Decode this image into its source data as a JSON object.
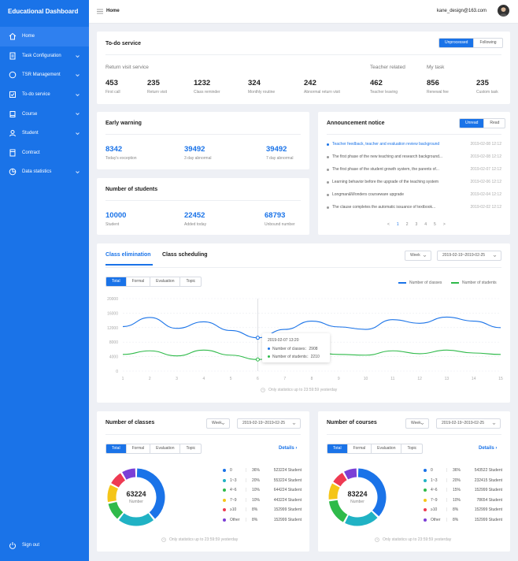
{
  "brand": "Educational Dashboard",
  "nav": [
    {
      "label": "Home",
      "icon": "home-icon",
      "active": true
    },
    {
      "label": "Task Configuration",
      "icon": "document-icon",
      "chevron": true
    },
    {
      "label": "TSR Management",
      "icon": "chat-icon",
      "chevron": true
    },
    {
      "label": "To-do service",
      "icon": "checklist-icon",
      "chevron": true
    },
    {
      "label": "Course",
      "icon": "book-icon",
      "chevron": true
    },
    {
      "label": "Student",
      "icon": "user-icon",
      "chevron": true
    },
    {
      "label": "Contract",
      "icon": "contract-icon"
    },
    {
      "label": "Data statistics",
      "icon": "pie-icon",
      "chevron": true
    }
  ],
  "signout": "Sign out",
  "topbar": {
    "crumb": "Home",
    "user": "kane_design@163.com"
  },
  "todo": {
    "title": "To-do service",
    "seg": [
      "Unprocessed",
      "Following"
    ],
    "group1": "Return visit service",
    "group2": "Teacher related",
    "group3": "My task",
    "stats": [
      {
        "n": "453",
        "l": "First call"
      },
      {
        "n": "235",
        "l": "Return visit"
      },
      {
        "n": "1232",
        "l": "Class reminder"
      },
      {
        "n": "324",
        "l": "Monthly routine"
      },
      {
        "n": "242",
        "l": "Abnormal return visit"
      },
      {
        "n": "462",
        "l": "Teacher leaving"
      },
      {
        "n": "856",
        "l": "Renewal fee"
      },
      {
        "n": "235",
        "l": "Custom task"
      }
    ]
  },
  "warning": {
    "title": "Early warning",
    "stats": [
      {
        "n": "8342",
        "l": "Today's exception"
      },
      {
        "n": "39492",
        "l": "3 day abnormal"
      },
      {
        "n": "39492",
        "l": "7 day abnormal"
      }
    ]
  },
  "students": {
    "title": "Number of students",
    "stats": [
      {
        "n": "10000",
        "l": "Student"
      },
      {
        "n": "22452",
        "l": "Added today"
      },
      {
        "n": "68793",
        "l": "Unbound number"
      }
    ]
  },
  "announce": {
    "title": "Announcement notice",
    "seg": [
      "Unread",
      "Read"
    ],
    "rows": [
      {
        "t": "Teacher feedback, teacher and evaluation review background",
        "d": "2019-02-08 12:12"
      },
      {
        "t": "The first phase of the new teaching and research background...",
        "d": "2019-02-08 12:12"
      },
      {
        "t": "The first phase of the student growth system, the parents of...",
        "d": "2019-02-07 12:12"
      },
      {
        "t": "Learning behavior before the upgrade of the teaching system",
        "d": "2019-02-06 12:12"
      },
      {
        "t": "Longman&Wonders courseware upgrade",
        "d": "2019-02-04 12:12"
      },
      {
        "t": "The clause completes the automatic issuance of textbook...",
        "d": "2019-02-02 12:12"
      }
    ],
    "pager": [
      "<",
      "1",
      "2",
      "3",
      "4",
      "5",
      ">"
    ]
  },
  "elim": {
    "tab1": "Class elimination",
    "tab2": "Class scheduling",
    "period": "Week",
    "range": "2019-02-19~2019-02-25",
    "seg": [
      "Total",
      "Formal",
      "Evaluation",
      "Topic"
    ],
    "legend1": "Number of classes",
    "legend2": "Number of students",
    "tooltip": {
      "date": "2019-02-07 13:20",
      "l1": "Number of classes：",
      "v1": "2908",
      "l2": "Number of students：",
      "v2": "2210"
    },
    "foot": "Only statistics up to 23:59:59 yesterday"
  },
  "chart_data": {
    "type": "line",
    "x": [
      "1",
      "2",
      "3",
      "4",
      "5",
      "6",
      "7",
      "8",
      "9",
      "10",
      "11",
      "12",
      "13",
      "14",
      "15"
    ],
    "ylim": [
      0,
      20000
    ],
    "yticks": [
      "0",
      "4000",
      "8000",
      "12000",
      "16000",
      "20000"
    ],
    "series": [
      {
        "name": "Number of classes",
        "color": "#1a73e8",
        "values": [
          12300,
          14800,
          11800,
          13600,
          11200,
          9200,
          11500,
          13800,
          12200,
          11500,
          14200,
          13200,
          14900,
          13800,
          12000
        ]
      },
      {
        "name": "Number of students",
        "color": "#2fba4a",
        "values": [
          4600,
          5600,
          4200,
          5800,
          4400,
          3200,
          4200,
          5200,
          4600,
          4400,
          5600,
          4800,
          5800,
          5000,
          4600
        ]
      }
    ]
  },
  "classes": {
    "title": "Number of classes",
    "period": "Week",
    "range": "2019-02-19~2019-02-25",
    "seg": [
      "Total",
      "Formal",
      "Evaluation",
      "Topic"
    ],
    "details": "Details",
    "center": "63224",
    "center_label": "Number",
    "rows": [
      {
        "n": "0",
        "p": "36%",
        "s": "523224 Student",
        "c": "#1a73e8"
      },
      {
        "n": "1~3",
        "p": "20%",
        "s": "553224 Student",
        "c": "#20b2c4"
      },
      {
        "n": "4~6",
        "p": "10%",
        "s": "644224 Student",
        "c": "#2fba4a"
      },
      {
        "n": "7~9",
        "p": "10%",
        "s": "443224 Student",
        "c": "#f5c518"
      },
      {
        "n": "≥10",
        "p": "8%",
        "s": "152999 Student",
        "c": "#ee3a52"
      },
      {
        "n": "Other",
        "p": "8%",
        "s": "152999 Student",
        "c": "#7b3fd6"
      }
    ],
    "foot": "Only statistics up to 23:59:59 yesterday"
  },
  "courses": {
    "title": "Number of courses",
    "period": "Week",
    "range": "2019-02-19~2019-02-25",
    "seg": [
      "Total",
      "Formal",
      "Evaluation",
      "Topic"
    ],
    "details": "Details",
    "center": "83224",
    "center_label": "Number",
    "rows": [
      {
        "n": "0",
        "p": "36%",
        "s": "543522 Student",
        "c": "#1a73e8"
      },
      {
        "n": "1~3",
        "p": "20%",
        "s": "232415 Student",
        "c": "#20b2c4"
      },
      {
        "n": "4~6",
        "p": "15%",
        "s": "152999 Student",
        "c": "#2fba4a"
      },
      {
        "n": "7~9",
        "p": "10%",
        "s": "78654 Student",
        "c": "#f5c518"
      },
      {
        "n": "≥10",
        "p": "8%",
        "s": "152999 Student",
        "c": "#ee3a52"
      },
      {
        "n": "Other",
        "p": "8%",
        "s": "152999 Student",
        "c": "#7b3fd6"
      }
    ],
    "foot": "Only statistics up to 23:59:59 yesterday"
  }
}
